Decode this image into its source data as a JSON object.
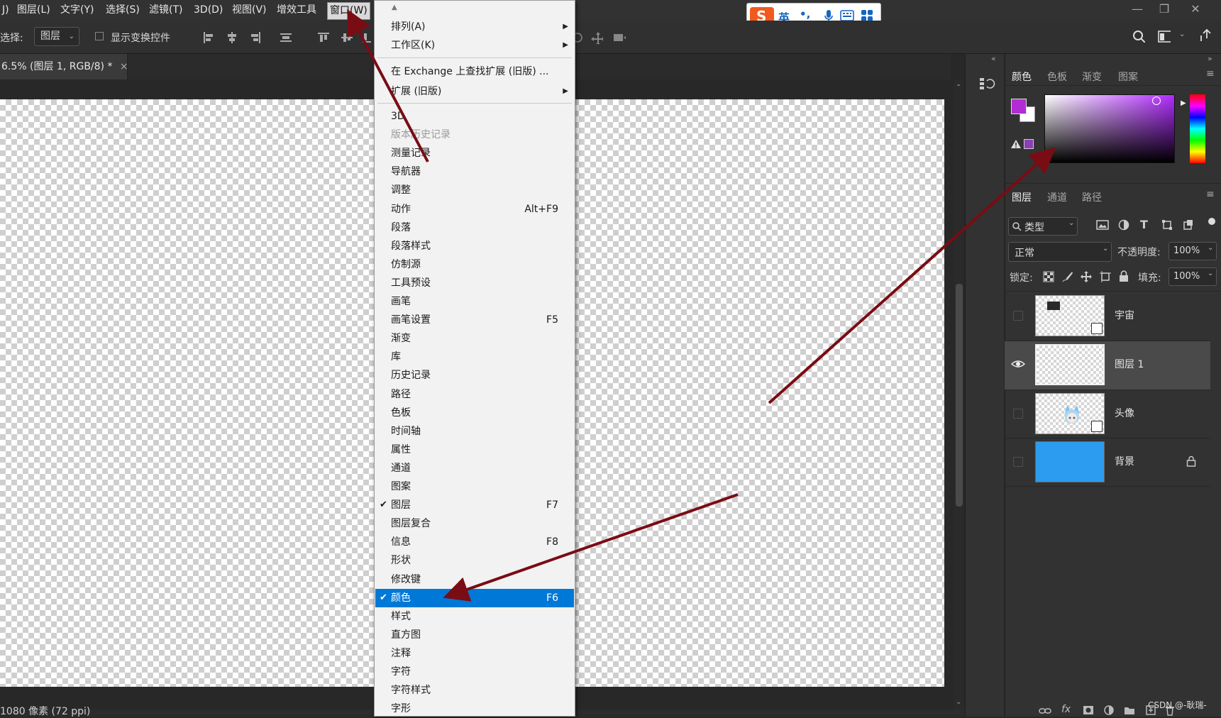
{
  "menubar": {
    "items": [
      "J)",
      "图层(L)",
      "文字(Y)",
      "选择(S)",
      "滤镜(T)",
      "3D(D)",
      "视图(V)",
      "增效工具",
      "窗口(W)"
    ]
  },
  "ime": {
    "language": "英",
    "punct": "•,",
    "mic": "mic",
    "keyboard": "keyboard",
    "apps": "apps"
  },
  "options": {
    "select_label": "选择:",
    "select_value": "图层",
    "show_transform": "显示变换控件"
  },
  "doc_tab": {
    "title": "6.5% (图层 1, RGB/8) *",
    "close": "×"
  },
  "status": {
    "text": "1080 像素 (72 ppi)"
  },
  "color_panel": {
    "tabs": [
      "颜色",
      "色板",
      "渐变",
      "图案"
    ],
    "fg_color": "#b22cd4",
    "bg_color": "#ffffff",
    "websafe_color": "#8b3fb5"
  },
  "layers_panel": {
    "tabs": [
      "图层",
      "通道",
      "路径"
    ],
    "filter_label": "类型",
    "blend_mode": "正常",
    "opacity_label": "不透明度:",
    "opacity_value": "100%",
    "lock_label": "锁定:",
    "fill_label": "填充:",
    "fill_value": "100%",
    "layers": [
      {
        "name": "宇宙",
        "visible": false,
        "selected": false,
        "smart_object": true,
        "thumb": "checker",
        "locked": false
      },
      {
        "name": "图层 1",
        "visible": true,
        "selected": true,
        "smart_object": false,
        "thumb": "checker",
        "locked": false
      },
      {
        "name": "头像",
        "visible": false,
        "selected": false,
        "smart_object": true,
        "thumb": "avatar",
        "locked": false
      },
      {
        "name": "背景",
        "visible": false,
        "selected": false,
        "smart_object": false,
        "thumb": "#2b9cf0",
        "locked": true
      }
    ]
  },
  "window_menu": {
    "items": [
      {
        "label": "排列(A)",
        "submenu": true
      },
      {
        "label": "工作区(K)",
        "submenu": true
      },
      {
        "label": "在 Exchange 上查找扩展 (旧版) ..."
      },
      {
        "label": "扩展 (旧版)",
        "submenu": true
      },
      {
        "label": "3D"
      },
      {
        "label": "版本历史记录",
        "disabled": true
      },
      {
        "label": "测量记录"
      },
      {
        "label": "导航器"
      },
      {
        "label": "调整"
      },
      {
        "label": "动作",
        "shortcut": "Alt+F9"
      },
      {
        "label": "段落"
      },
      {
        "label": "段落样式"
      },
      {
        "label": "仿制源"
      },
      {
        "label": "工具预设"
      },
      {
        "label": "画笔"
      },
      {
        "label": "画笔设置",
        "shortcut": "F5"
      },
      {
        "label": "渐变"
      },
      {
        "label": "库"
      },
      {
        "label": "历史记录"
      },
      {
        "label": "路径"
      },
      {
        "label": "色板"
      },
      {
        "label": "时间轴"
      },
      {
        "label": "属性"
      },
      {
        "label": "通道"
      },
      {
        "label": "图案"
      },
      {
        "label": "图层",
        "shortcut": "F7",
        "checked": true
      },
      {
        "label": "图层复合"
      },
      {
        "label": "信息",
        "shortcut": "F8"
      },
      {
        "label": "形状"
      },
      {
        "label": "修改键"
      },
      {
        "label": "颜色",
        "shortcut": "F6",
        "checked": true,
        "highlight": true
      },
      {
        "label": "样式"
      },
      {
        "label": "直方图"
      },
      {
        "label": "注释"
      },
      {
        "label": "字符"
      },
      {
        "label": "字符样式"
      },
      {
        "label": "字形"
      }
    ]
  },
  "annotation_color": "#7a0c14",
  "watermark": "CSDN @-耿瑞-"
}
